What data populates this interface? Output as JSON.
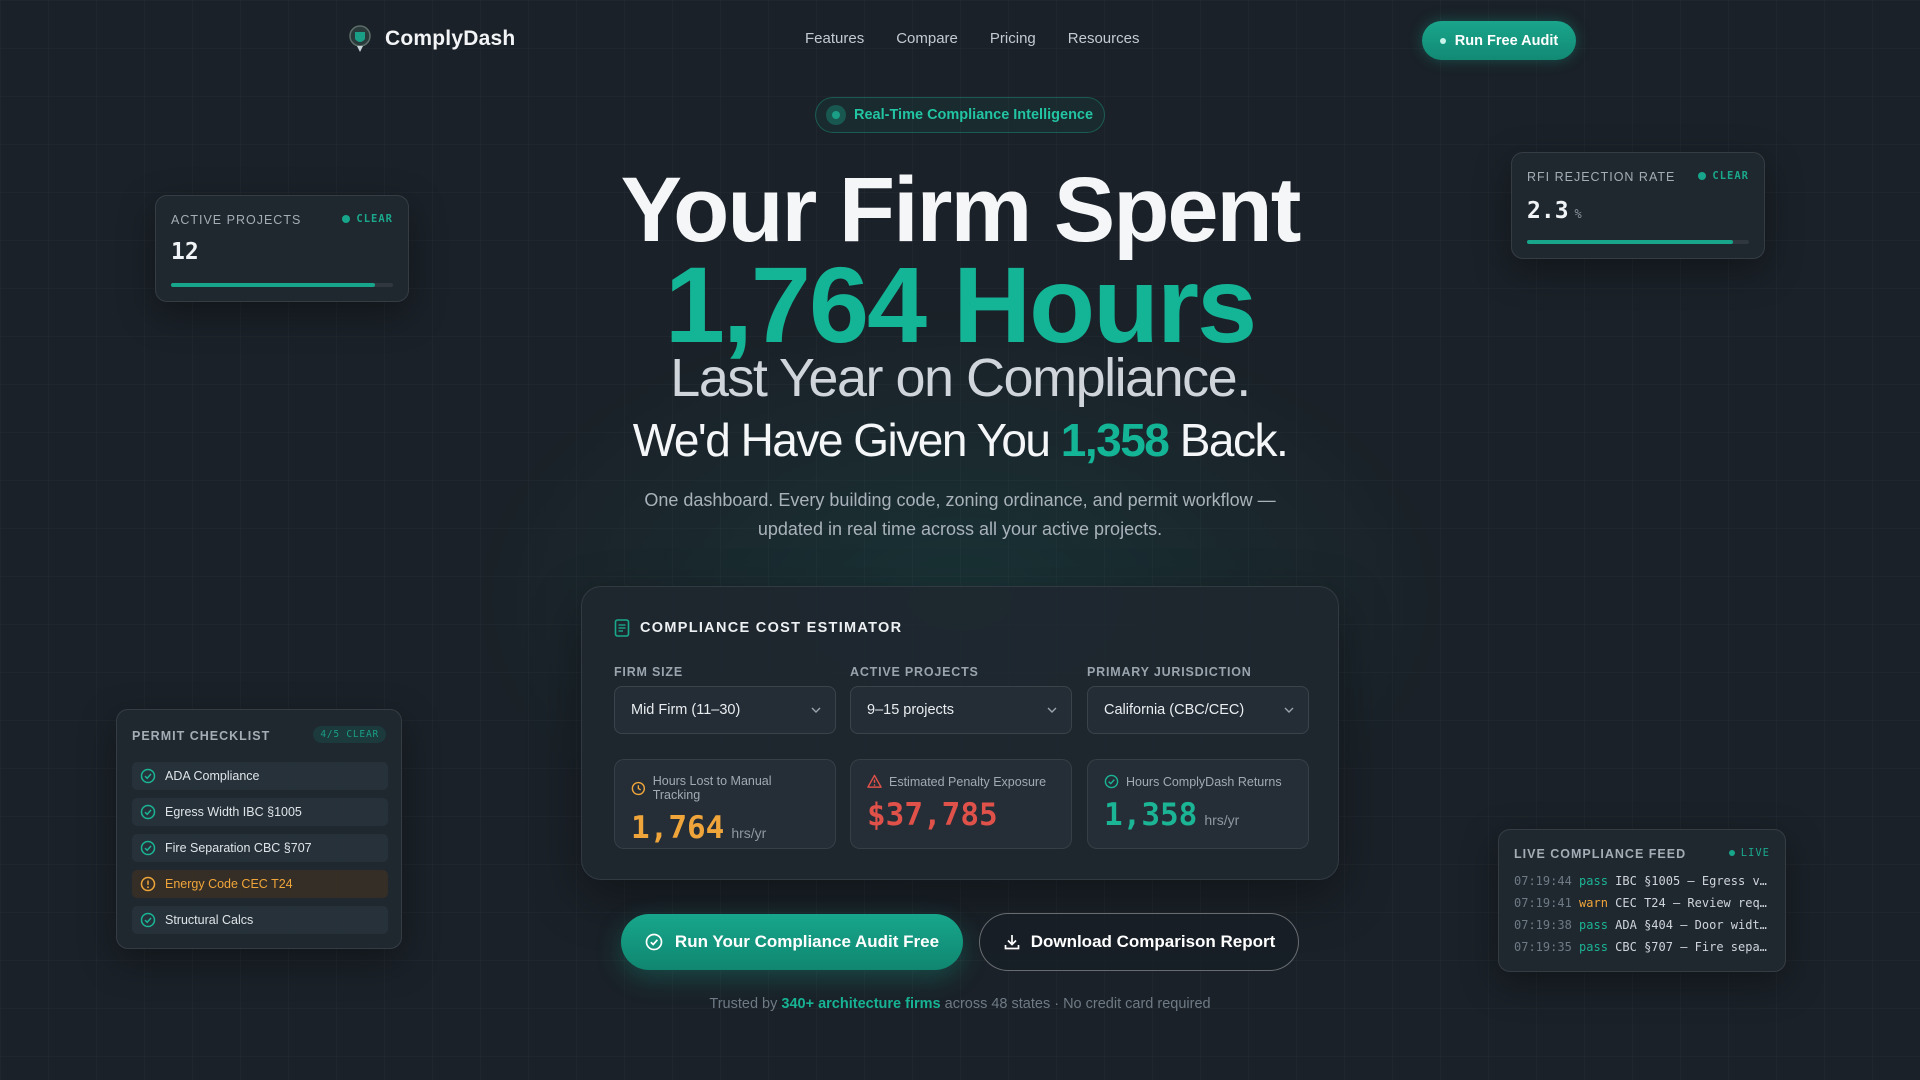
{
  "brand": {
    "name": "ComplyDash"
  },
  "nav": {
    "links": [
      "Features",
      "Compare",
      "Pricing",
      "Resources"
    ],
    "cta": "Run Free Audit"
  },
  "hero": {
    "badge": "Real-Time Compliance Intelligence",
    "line1": "Your Firm Spent",
    "line2": "1,764 Hours",
    "line3": "Last Year on Compliance.",
    "line4_prefix": "We'd Have Given You",
    "line4_number": "1,358",
    "line4_suffix": "Back.",
    "subtitle_line1": "One dashboard. Every building code, zoning ordinance, and permit workflow —",
    "subtitle_line2": "updated in real time across all your active projects."
  },
  "estimator": {
    "title": "COMPLIANCE COST ESTIMATOR",
    "fields": [
      {
        "label": "FIRM SIZE",
        "value": "Mid Firm (11–30)"
      },
      {
        "label": "ACTIVE PROJECTS",
        "value": "9–15 projects"
      },
      {
        "label": "PRIMARY JURISDICTION",
        "value": "California (CBC/CEC)"
      }
    ],
    "stats": [
      {
        "label": "Hours Lost to Manual Tracking",
        "value": "1,764",
        "unit": "hrs/yr",
        "color": "#f0a53a",
        "icon": "clock-icon"
      },
      {
        "label": "Estimated Penalty Exposure",
        "value": "$37,785",
        "unit": "",
        "color": "#e0514a",
        "icon": "alert-triangle-icon"
      },
      {
        "label": "Hours ComplyDash Returns",
        "value": "1,358",
        "unit": "hrs/yr",
        "color": "#1bb596",
        "icon": "check-circle-icon"
      }
    ]
  },
  "ctas": {
    "primary": "Run Your Compliance Audit Free",
    "secondary": "Download Comparison Report"
  },
  "trust": {
    "prefix": "Trusted by",
    "highlight": "340+ architecture firms",
    "suffix": "across 48 states · No credit card required"
  },
  "cards": {
    "active_projects": {
      "label": "ACTIVE PROJECTS",
      "status": "CLEAR",
      "value": "12",
      "progress": 0.92
    },
    "rfi_rate": {
      "label": "RFI REJECTION RATE",
      "status": "CLEAR",
      "value": "2.3",
      "unit": "%",
      "progress": 0.93
    },
    "permit_checklist": {
      "title": "PERMIT CHECKLIST",
      "badge": "4/5 CLEAR",
      "items": [
        {
          "label": "ADA Compliance",
          "state": "pass"
        },
        {
          "label": "Egress Width IBC §1005",
          "state": "pass"
        },
        {
          "label": "Fire Separation CBC §707",
          "state": "pass"
        },
        {
          "label": "Energy Code CEC T24",
          "state": "warn"
        },
        {
          "label": "Structural Calcs",
          "state": "pass"
        }
      ]
    },
    "live_feed": {
      "title": "LIVE COMPLIANCE FEED",
      "status": "LIVE",
      "entries": [
        {
          "time": "07:19:44",
          "level": "pass",
          "text": "IBC §1005 — Egress v…"
        },
        {
          "time": "07:19:41",
          "level": "warn",
          "text": "CEC T24 — Review req…"
        },
        {
          "time": "07:19:38",
          "level": "pass",
          "text": "ADA §404 — Door widt…"
        },
        {
          "time": "07:19:35",
          "level": "pass",
          "text": "CBC §707 — Fire sepa…"
        }
      ]
    }
  },
  "colors": {
    "accent": "#14b496",
    "warn": "#f0a53a",
    "danger": "#e0514a",
    "background": "#1a2128"
  }
}
